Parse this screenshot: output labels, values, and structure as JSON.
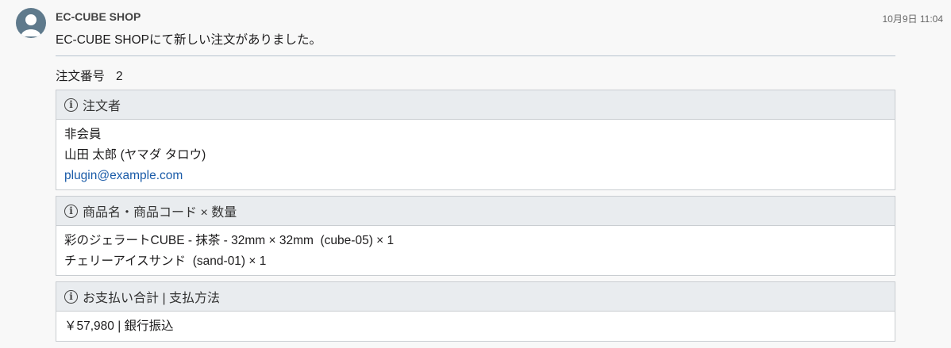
{
  "message": {
    "sender": "EC-CUBE SHOP",
    "timestamp": "10月9日 11:04",
    "text": "EC-CUBE SHOPにて新しい注文がありました。"
  },
  "order": {
    "number_label": "注文番号",
    "number_value": "2"
  },
  "customer_panel": {
    "title": "注文者",
    "member_status": "非会員",
    "name": "山田 太郎 (ヤマダ タロウ)",
    "email": "plugin@example.com"
  },
  "products_panel": {
    "title": "商品名・商品コード × 数量",
    "items": [
      "彩のジェラートCUBE - 抹茶 - 32mm × 32mm  (cube-05) × 1",
      "チェリーアイスサンド  (sand-01) × 1"
    ]
  },
  "payment_panel": {
    "title": "お支払い合計 | 支払方法",
    "value": "￥57,980 | 銀行振込"
  },
  "icons": {
    "avatar": "user-avatar-icon",
    "info": "info-circle-icon"
  },
  "colors": {
    "link": "#1a5ba8",
    "panel_header": "#e9ecef",
    "avatar": "#5f7a8c"
  }
}
